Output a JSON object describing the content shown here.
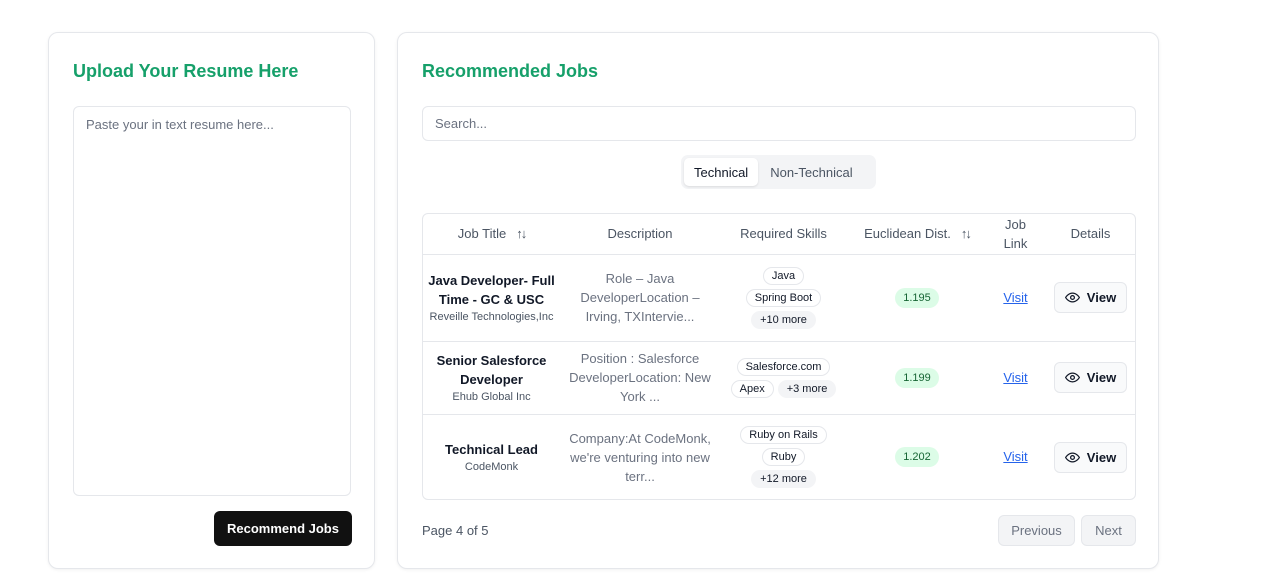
{
  "upload": {
    "title": "Upload Your Resume Here",
    "placeholder": "Paste your in text resume here...",
    "button_label": "Recommend Jobs"
  },
  "jobs": {
    "title": "Recommended Jobs",
    "search_placeholder": "Search...",
    "tabs": [
      {
        "label": "Technical",
        "active": true
      },
      {
        "label": "Non-Technical",
        "active": false
      }
    ],
    "columns": {
      "title": "Job Title",
      "description": "Description",
      "skills": "Required Skills",
      "distance": "Euclidean Dist.",
      "link_line1": "Job",
      "link_line2": "Link",
      "details": "Details"
    },
    "rows": [
      {
        "title": "Java Developer- Full Time - GC & USC",
        "company": "Reveille Technologies,Inc",
        "description": "Role – Java DeveloperLocation – Irving, TXIntervie...",
        "skills": [
          "Java",
          "Spring Boot"
        ],
        "more": "+10 more",
        "distance": "1.195",
        "link": "Visit",
        "view": "View"
      },
      {
        "title": "Senior Salesforce Developer",
        "company": "Ehub Global Inc",
        "description": "Position : Salesforce DeveloperLocation: New York ...",
        "skills": [
          "Salesforce.com",
          "Apex"
        ],
        "more": "+3 more",
        "distance": "1.199",
        "link": "Visit",
        "view": "View"
      },
      {
        "title": "Technical Lead",
        "company": "CodeMonk",
        "description": "Company:At CodeMonk, we're venturing into new terr...",
        "skills": [
          "Ruby on Rails",
          "Ruby"
        ],
        "more": "+12 more",
        "distance": "1.202",
        "link": "Visit",
        "view": "View"
      }
    ],
    "pagination": {
      "info": "Page 4 of 5",
      "previous": "Previous",
      "next": "Next"
    }
  },
  "colors": {
    "accent_green": "#16a06a",
    "badge_green_bg": "#dcfce7",
    "link_blue": "#2563eb",
    "primary_button": "#111111"
  }
}
